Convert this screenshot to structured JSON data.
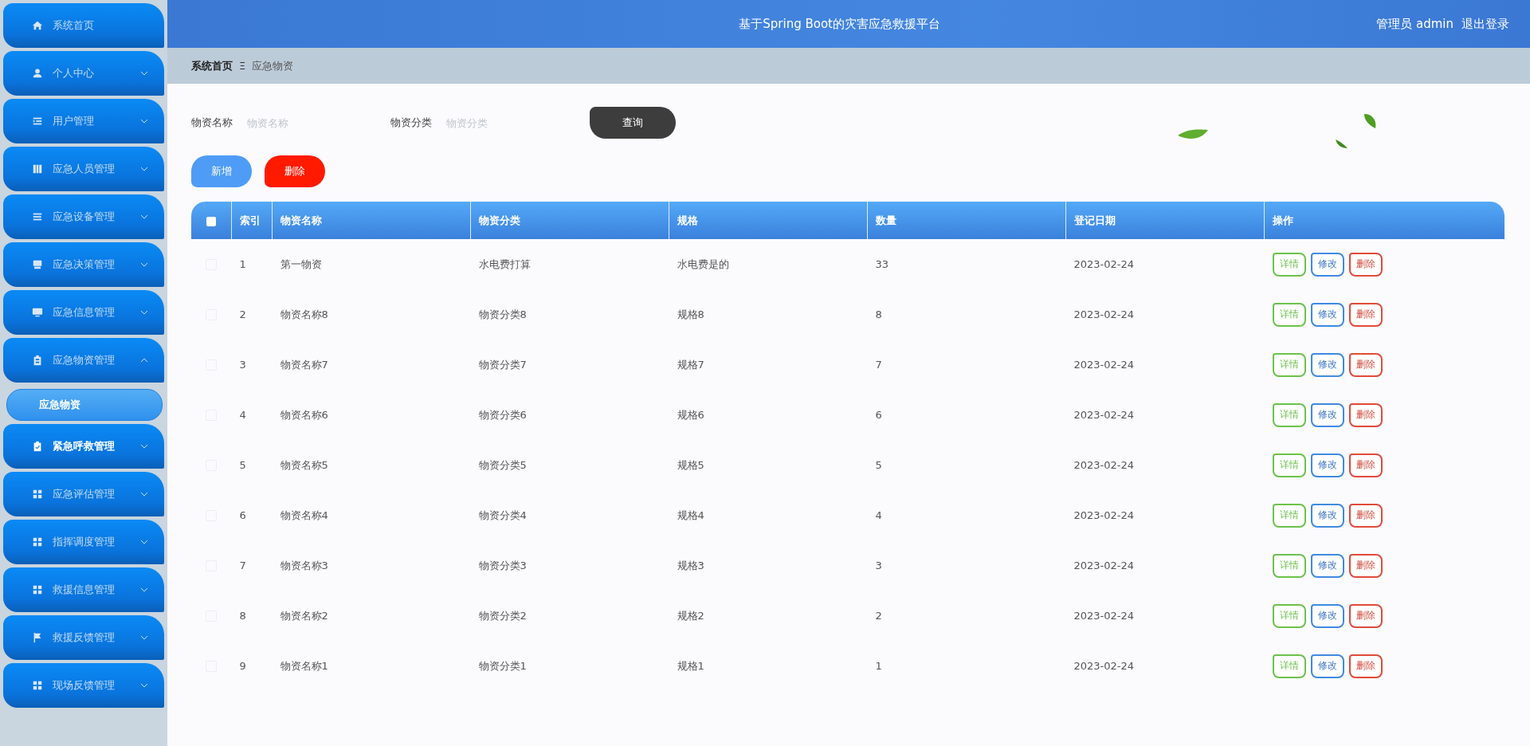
{
  "sidebar": {
    "items": [
      {
        "label": "系统首页",
        "has_submenu": false,
        "expanded": false,
        "hovered": false
      },
      {
        "label": "个人中心",
        "has_submenu": true,
        "expanded": false,
        "hovered": false
      },
      {
        "label": "用户管理",
        "has_submenu": true,
        "expanded": false,
        "hovered": false
      },
      {
        "label": "应急人员管理",
        "has_submenu": true,
        "expanded": false,
        "hovered": false
      },
      {
        "label": "应急设备管理",
        "has_submenu": true,
        "expanded": false,
        "hovered": false
      },
      {
        "label": "应急决策管理",
        "has_submenu": true,
        "expanded": false,
        "hovered": false
      },
      {
        "label": "应急信息管理",
        "has_submenu": true,
        "expanded": false,
        "hovered": false
      },
      {
        "label": "应急物资管理",
        "has_submenu": true,
        "expanded": true,
        "hovered": false,
        "children": [
          {
            "label": "应急物资",
            "selected": true
          }
        ]
      },
      {
        "label": "紧急呼救管理",
        "has_submenu": true,
        "expanded": false,
        "hovered": true
      },
      {
        "label": "应急评估管理",
        "has_submenu": true,
        "expanded": false,
        "hovered": false
      },
      {
        "label": "指挥调度管理",
        "has_submenu": true,
        "expanded": false,
        "hovered": false
      },
      {
        "label": "救援信息管理",
        "has_submenu": true,
        "expanded": false,
        "hovered": false
      },
      {
        "label": "救援反馈管理",
        "has_submenu": true,
        "expanded": false,
        "hovered": false
      },
      {
        "label": "现场反馈管理",
        "has_submenu": true,
        "expanded": false,
        "hovered": false
      }
    ]
  },
  "header": {
    "title": "基于Spring Boot的灾害应急救援平台",
    "user": "管理员 admin",
    "logout": "退出登录"
  },
  "breadcrumb": {
    "items": [
      "系统首页",
      "应急物资"
    ],
    "separator": "Ξ"
  },
  "search": {
    "fields": [
      {
        "label": "物资名称",
        "placeholder": "物资名称"
      },
      {
        "label": "物资分类",
        "placeholder": "物资分类"
      }
    ],
    "button": "查询"
  },
  "actions": [
    {
      "label": "新增",
      "kind": "add"
    },
    {
      "label": "删除",
      "kind": "delete"
    }
  ],
  "table": {
    "header_checked": false,
    "columns": [
      "索引",
      "物资名称",
      "物资分类",
      "规格",
      "数量",
      "登记日期",
      "操作"
    ],
    "rows": [
      {
        "checked": false,
        "cells": [
          "1",
          "第一物资",
          "水电费打算",
          "水电费是的",
          "33",
          "2023-02-24"
        ],
        "actions": [
          {
            "label": "详情",
            "kind": "detail"
          },
          {
            "label": "修改",
            "kind": "edit"
          },
          {
            "label": "删除",
            "kind": "delete"
          }
        ]
      },
      {
        "checked": false,
        "cells": [
          "2",
          "物资名称8",
          "物资分类8",
          "规格8",
          "8",
          "2023-02-24"
        ],
        "actions": [
          {
            "label": "详情",
            "kind": "detail"
          },
          {
            "label": "修改",
            "kind": "edit"
          },
          {
            "label": "删除",
            "kind": "delete"
          }
        ]
      },
      {
        "checked": false,
        "cells": [
          "3",
          "物资名称7",
          "物资分类7",
          "规格7",
          "7",
          "2023-02-24"
        ],
        "actions": [
          {
            "label": "详情",
            "kind": "detail"
          },
          {
            "label": "修改",
            "kind": "edit"
          },
          {
            "label": "删除",
            "kind": "delete"
          }
        ]
      },
      {
        "checked": false,
        "cells": [
          "4",
          "物资名称6",
          "物资分类6",
          "规格6",
          "6",
          "2023-02-24"
        ],
        "actions": [
          {
            "label": "详情",
            "kind": "detail"
          },
          {
            "label": "修改",
            "kind": "edit"
          },
          {
            "label": "删除",
            "kind": "delete"
          }
        ]
      },
      {
        "checked": false,
        "cells": [
          "5",
          "物资名称5",
          "物资分类5",
          "规格5",
          "5",
          "2023-02-24"
        ],
        "actions": [
          {
            "label": "详情",
            "kind": "detail"
          },
          {
            "label": "修改",
            "kind": "edit"
          },
          {
            "label": "删除",
            "kind": "delete"
          }
        ]
      },
      {
        "checked": false,
        "cells": [
          "6",
          "物资名称4",
          "物资分类4",
          "规格4",
          "4",
          "2023-02-24"
        ],
        "actions": [
          {
            "label": "详情",
            "kind": "detail"
          },
          {
            "label": "修改",
            "kind": "edit"
          },
          {
            "label": "删除",
            "kind": "delete"
          }
        ]
      },
      {
        "checked": false,
        "cells": [
          "7",
          "物资名称3",
          "物资分类3",
          "规格3",
          "3",
          "2023-02-24"
        ],
        "actions": [
          {
            "label": "详情",
            "kind": "detail"
          },
          {
            "label": "修改",
            "kind": "edit"
          },
          {
            "label": "删除",
            "kind": "delete"
          }
        ]
      },
      {
        "checked": false,
        "cells": [
          "8",
          "物资名称2",
          "物资分类2",
          "规格2",
          "2",
          "2023-02-24"
        ],
        "actions": [
          {
            "label": "详情",
            "kind": "detail"
          },
          {
            "label": "修改",
            "kind": "edit"
          },
          {
            "label": "删除",
            "kind": "delete"
          }
        ]
      },
      {
        "checked": false,
        "cells": [
          "9",
          "物资名称1",
          "物资分类1",
          "规格1",
          "1",
          "2023-02-24"
        ],
        "actions": [
          {
            "label": "详情",
            "kind": "detail"
          },
          {
            "label": "修改",
            "kind": "edit"
          },
          {
            "label": "删除",
            "kind": "delete"
          }
        ]
      }
    ]
  }
}
